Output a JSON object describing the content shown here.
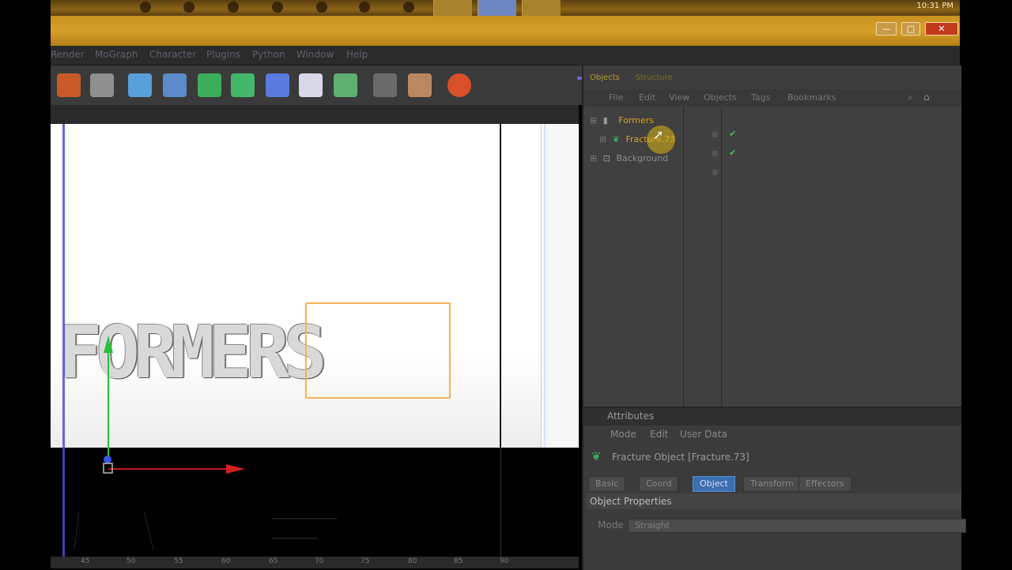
{
  "taskbar": {
    "clock": "10:31 PM"
  },
  "window": {
    "min": "—",
    "max": "□",
    "close": "✕"
  },
  "menu": [
    "Render",
    "MoGraph",
    "Character",
    "Plugins",
    "Python",
    "Window",
    "Help"
  ],
  "toolbar": {
    "icons": [
      "render-settings-icon",
      "render-picture-icon",
      "cube-icon",
      "nurbs-icon",
      "array-icon",
      "cloner-icon",
      "deformer-icon",
      "light-icon",
      "particles-icon",
      "scene-icon",
      "timeline-icon",
      "web-icon"
    ]
  },
  "viewport": {
    "scene_text": "FORMERS",
    "timeline_ticks": [
      "45",
      "50",
      "55",
      "60",
      "65",
      "70",
      "75",
      "80",
      "85",
      "90"
    ]
  },
  "objects": {
    "tabs": [
      "Objects",
      "Structure"
    ],
    "menu": [
      "File",
      "Edit",
      "View",
      "Objects",
      "Tags",
      "Bookmarks"
    ],
    "rows": [
      {
        "name": "Formers",
        "indent": 0,
        "active": true
      },
      {
        "name": "Fracture.73",
        "indent": 1,
        "active": true
      },
      {
        "name": "Background",
        "indent": 0,
        "active": false
      }
    ]
  },
  "attributes": {
    "title": "Attributes",
    "menu": [
      "Mode",
      "Edit",
      "User Data"
    ],
    "object_title": "Fracture Object [Fracture.73]",
    "tabs": [
      "Basic",
      "Coord",
      "Object",
      "Transform",
      "Effectors"
    ],
    "active_tab": "Object",
    "section": "Object Properties",
    "mode_label": "Mode",
    "mode_value": "Straight"
  }
}
